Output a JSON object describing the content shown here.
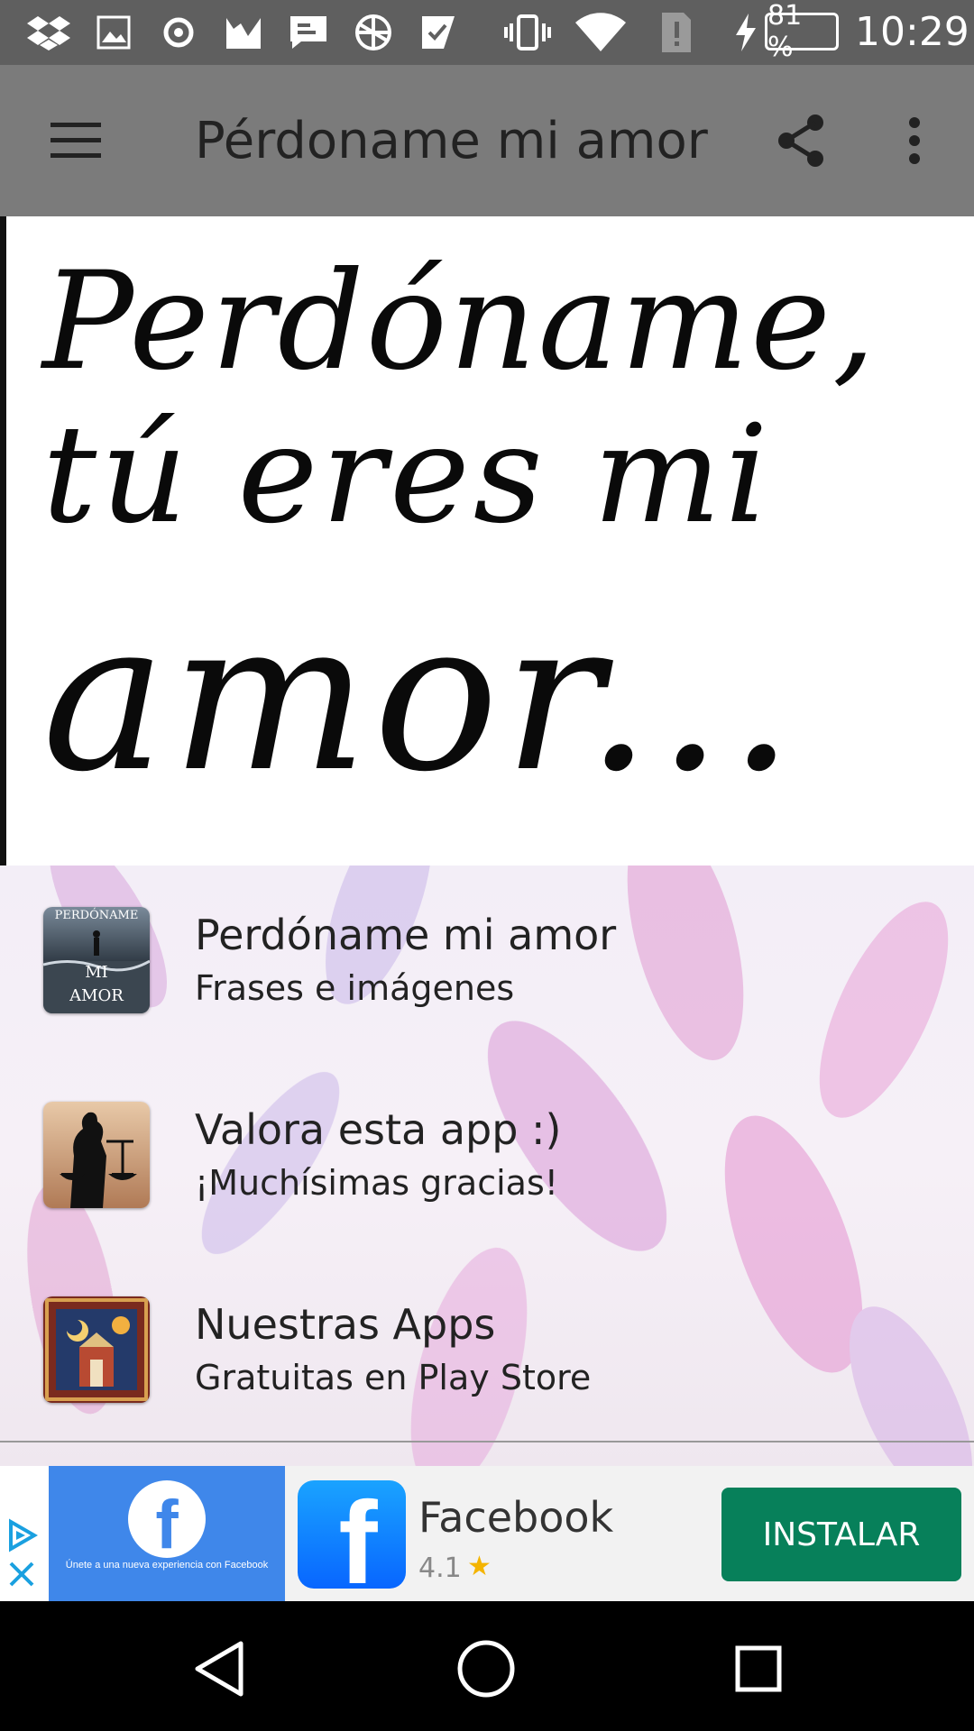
{
  "status_bar": {
    "battery": "81 %",
    "time": "10:29"
  },
  "app_bar": {
    "title": "Pérdoname mi amor"
  },
  "header_image": {
    "line1": "Perdóname,",
    "line2": "tú eres mi",
    "line3": "amor..."
  },
  "list": {
    "items": [
      {
        "title": "Perdóname mi amor",
        "subtitle": "Frases e imágenes",
        "thumb_text_top": "PERDÓNAME",
        "thumb_text_mid": "MI",
        "thumb_text_bot": "AMOR"
      },
      {
        "title": "Valora esta app :)",
        "subtitle": "¡Muchísimas gracias!"
      },
      {
        "title": "Nuestras Apps",
        "subtitle": "Gratuitas en Play Store"
      }
    ]
  },
  "ad": {
    "promo_tagline": "Únete a una nueva experiencia con Facebook",
    "app_name": "Facebook",
    "rating": "4.1",
    "install_label": "INSTALAR",
    "brand_color": "#3f87ea",
    "install_color": "#07805a"
  },
  "icons": {
    "status": [
      "dropbox-icon",
      "image-icon",
      "sync-icon",
      "analytics-icon",
      "message-icon",
      "globe-icon",
      "check-icon",
      "vibrate-icon",
      "wifi-icon",
      "sim-alert-icon",
      "charging-icon"
    ],
    "app_bar": [
      "menu-icon",
      "share-icon",
      "more-vert-icon"
    ],
    "nav": [
      "back-icon",
      "home-icon",
      "recents-icon"
    ]
  }
}
